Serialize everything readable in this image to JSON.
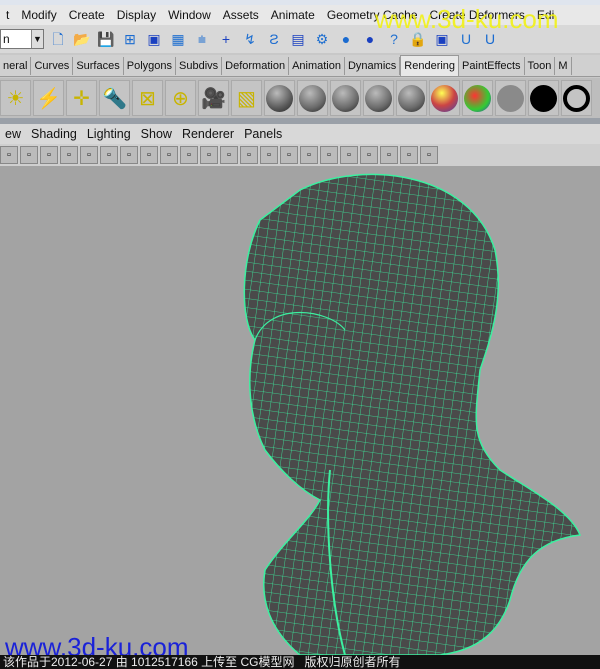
{
  "menubar": {
    "items": [
      "t",
      "Modify",
      "Create",
      "Display",
      "Window",
      "Assets",
      "Animate",
      "Geometry Cache",
      "Create Deformers",
      "Edi"
    ]
  },
  "toolbar": {
    "mode_value": "n",
    "icons": [
      "new-scene",
      "open-scene",
      "save-scene",
      "select-hierarchy",
      "select-object",
      "select-component",
      "snap-grid",
      "snap-curve",
      "snap-point",
      "snap-plane",
      "construction-history",
      "render",
      "ipr-render",
      "render-settings",
      "help",
      "lock",
      "select-lock",
      "magnet",
      "magnet-curve"
    ]
  },
  "shelf_tabs": {
    "items": [
      "neral",
      "Curves",
      "Surfaces",
      "Polygons",
      "Subdivs",
      "Deformation",
      "Animation",
      "Dynamics",
      "Rendering",
      "PaintEffects",
      "Toon",
      "M"
    ],
    "active": "Rendering"
  },
  "shelf": {
    "icons": [
      "ambient-light",
      "directional-light",
      "point-light",
      "spot-light",
      "area-light",
      "volume-light",
      "camera",
      "hypershade",
      "blinn",
      "phong",
      "lambert",
      "phong-e",
      "anisotropic",
      "layered-shader",
      "ramp-shader",
      "surface-shader",
      "use-background",
      "ocean-shader"
    ],
    "colors": [
      "#5a5a5a",
      "#6a6a6a",
      "#6a6a6a",
      "#6a6a6a",
      "#6a6a6a",
      "#b0a060",
      "#e04a3a",
      "#8a8a8a",
      "#000000",
      "#ffffff"
    ]
  },
  "panel_menu": {
    "items": [
      "ew",
      "Shading",
      "Lighting",
      "Show",
      "Renderer",
      "Panels"
    ]
  },
  "panel_tools": {
    "icons": [
      "camera-select",
      "camera-attr",
      "bookmark",
      "image-plane",
      "grid",
      "film-gate",
      "resolution-gate",
      "field-chart",
      "safe-action",
      "safe-title",
      "gate-mask",
      "wireframe",
      "smooth-shade",
      "flat-shade",
      "textured",
      "use-lights",
      "shadows",
      "xray",
      "isolate-select",
      "wireframe-on-shaded",
      "backface",
      "joint-xray"
    ]
  },
  "viewport": {
    "background": "#a3a3a3",
    "mesh_color": "#3cf0a0",
    "model_color": "#4a4a4a"
  },
  "watermarks": {
    "top": "www.3d-ku.com",
    "bottom": "www.3d-ku.com"
  },
  "footer": {
    "text": "该作品于2012-06-27 由 1012517166 上传至 CG模型网   版权归原创者所有"
  }
}
